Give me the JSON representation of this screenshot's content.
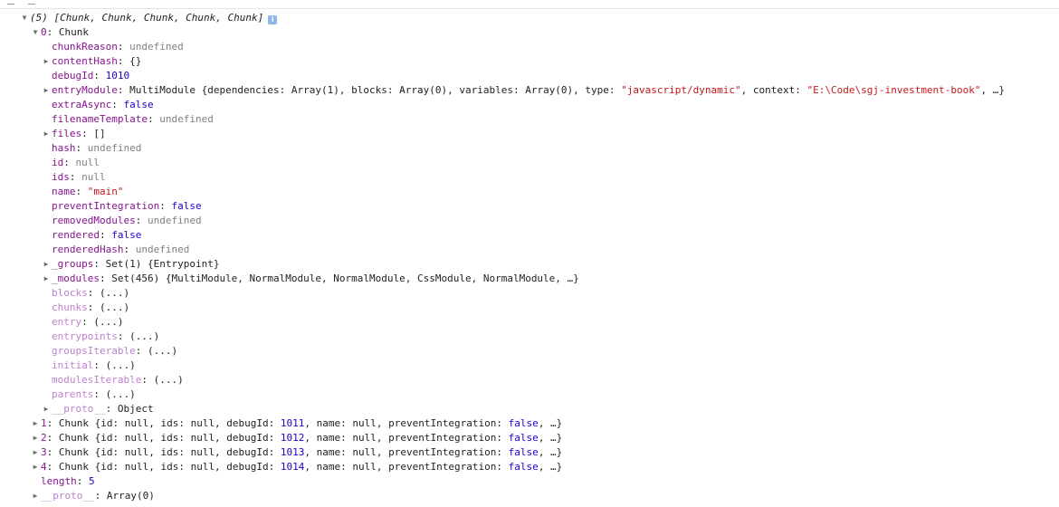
{
  "header": {
    "array_summary": "(5) [Chunk, Chunk, Chunk, Chunk, Chunk]",
    "info_icon_glyph": "i"
  },
  "rows": [
    {
      "indent": 1,
      "arrow": "down",
      "key": "0",
      "sep": ": ",
      "value": "Chunk",
      "vtype": "g"
    },
    {
      "indent": 2,
      "arrow": "none",
      "key": "chunkReason",
      "sep": ": ",
      "value": "undefined",
      "vtype": "u"
    },
    {
      "indent": 2,
      "arrow": "right",
      "key": "contentHash",
      "sep": ": ",
      "value": "{}",
      "vtype": "g"
    },
    {
      "indent": 2,
      "arrow": "none",
      "key": "debugId",
      "sep": ": ",
      "value": "1010",
      "vtype": "n"
    },
    {
      "indent": 2,
      "arrow": "right",
      "key": "entryModule",
      "sep": ": ",
      "vtype": "parts",
      "parts": [
        {
          "t": "MultiModule {dependencies: Array(1), blocks: Array(0), variables: Array(0), type: ",
          "c": "g"
        },
        {
          "t": "\"javascript/dynamic\"",
          "c": "s"
        },
        {
          "t": ", context: ",
          "c": "g"
        },
        {
          "t": "\"E:\\Code\\sgj-investment-book\"",
          "c": "s"
        },
        {
          "t": ", …}",
          "c": "g"
        }
      ]
    },
    {
      "indent": 2,
      "arrow": "none",
      "key": "extraAsync",
      "sep": ": ",
      "value": "false",
      "vtype": "n"
    },
    {
      "indent": 2,
      "arrow": "none",
      "key": "filenameTemplate",
      "sep": ": ",
      "value": "undefined",
      "vtype": "u"
    },
    {
      "indent": 2,
      "arrow": "right",
      "key": "files",
      "sep": ": ",
      "value": "[]",
      "vtype": "g"
    },
    {
      "indent": 2,
      "arrow": "none",
      "key": "hash",
      "sep": ": ",
      "value": "undefined",
      "vtype": "u"
    },
    {
      "indent": 2,
      "arrow": "none",
      "key": "id",
      "sep": ": ",
      "value": "null",
      "vtype": "u"
    },
    {
      "indent": 2,
      "arrow": "none",
      "key": "ids",
      "sep": ": ",
      "value": "null",
      "vtype": "u"
    },
    {
      "indent": 2,
      "arrow": "none",
      "key": "name",
      "sep": ": ",
      "value": "\"main\"",
      "vtype": "s"
    },
    {
      "indent": 2,
      "arrow": "none",
      "key": "preventIntegration",
      "sep": ": ",
      "value": "false",
      "vtype": "n"
    },
    {
      "indent": 2,
      "arrow": "none",
      "key": "removedModules",
      "sep": ": ",
      "value": "undefined",
      "vtype": "u"
    },
    {
      "indent": 2,
      "arrow": "none",
      "key": "rendered",
      "sep": ": ",
      "value": "false",
      "vtype": "n"
    },
    {
      "indent": 2,
      "arrow": "none",
      "key": "renderedHash",
      "sep": ": ",
      "value": "undefined",
      "vtype": "u"
    },
    {
      "indent": 2,
      "arrow": "right",
      "key": "_groups",
      "sep": ": ",
      "value": "Set(1) {Entrypoint}",
      "vtype": "g"
    },
    {
      "indent": 2,
      "arrow": "right",
      "key": "_modules",
      "sep": ": ",
      "value": "Set(456) {MultiModule, NormalModule, NormalModule, CssModule, NormalModule, …}",
      "vtype": "g"
    },
    {
      "indent": 2,
      "arrow": "none",
      "key": "blocks",
      "sep": ": ",
      "value": "(...)",
      "vtype": "g",
      "dim": true
    },
    {
      "indent": 2,
      "arrow": "none",
      "key": "chunks",
      "sep": ": ",
      "value": "(...)",
      "vtype": "g",
      "dim": true
    },
    {
      "indent": 2,
      "arrow": "none",
      "key": "entry",
      "sep": ": ",
      "value": "(...)",
      "vtype": "g",
      "dim": true
    },
    {
      "indent": 2,
      "arrow": "none",
      "key": "entrypoints",
      "sep": ": ",
      "value": "(...)",
      "vtype": "g",
      "dim": true
    },
    {
      "indent": 2,
      "arrow": "none",
      "key": "groupsIterable",
      "sep": ": ",
      "value": "(...)",
      "vtype": "g",
      "dim": true
    },
    {
      "indent": 2,
      "arrow": "none",
      "key": "initial",
      "sep": ": ",
      "value": "(...)",
      "vtype": "g",
      "dim": true
    },
    {
      "indent": 2,
      "arrow": "none",
      "key": "modulesIterable",
      "sep": ": ",
      "value": "(...)",
      "vtype": "g",
      "dim": true
    },
    {
      "indent": 2,
      "arrow": "none",
      "key": "parents",
      "sep": ": ",
      "value": "(...)",
      "vtype": "g",
      "dim": true
    },
    {
      "indent": 2,
      "arrow": "right",
      "key": "__proto__",
      "sep": ": ",
      "value": "Object",
      "vtype": "g",
      "dim": true
    },
    {
      "indent": 1,
      "arrow": "right",
      "key": "1",
      "sep": ": ",
      "vtype": "parts",
      "parts": [
        {
          "t": "Chunk {id: null, ids: null, debugId: ",
          "c": "g"
        },
        {
          "t": "1011",
          "c": "n"
        },
        {
          "t": ", name: null, preventIntegration: ",
          "c": "g"
        },
        {
          "t": "false",
          "c": "n"
        },
        {
          "t": ", …}",
          "c": "g"
        }
      ]
    },
    {
      "indent": 1,
      "arrow": "right",
      "key": "2",
      "sep": ": ",
      "vtype": "parts",
      "parts": [
        {
          "t": "Chunk {id: null, ids: null, debugId: ",
          "c": "g"
        },
        {
          "t": "1012",
          "c": "n"
        },
        {
          "t": ", name: null, preventIntegration: ",
          "c": "g"
        },
        {
          "t": "false",
          "c": "n"
        },
        {
          "t": ", …}",
          "c": "g"
        }
      ]
    },
    {
      "indent": 1,
      "arrow": "right",
      "key": "3",
      "sep": ": ",
      "vtype": "parts",
      "parts": [
        {
          "t": "Chunk {id: null, ids: null, debugId: ",
          "c": "g"
        },
        {
          "t": "1013",
          "c": "n"
        },
        {
          "t": ", name: null, preventIntegration: ",
          "c": "g"
        },
        {
          "t": "false",
          "c": "n"
        },
        {
          "t": ", …}",
          "c": "g"
        }
      ]
    },
    {
      "indent": 1,
      "arrow": "right",
      "key": "4",
      "sep": ": ",
      "vtype": "parts",
      "parts": [
        {
          "t": "Chunk {id: null, ids: null, debugId: ",
          "c": "g"
        },
        {
          "t": "1014",
          "c": "n"
        },
        {
          "t": ", name: null, preventIntegration: ",
          "c": "g"
        },
        {
          "t": "false",
          "c": "n"
        },
        {
          "t": ", …}",
          "c": "g"
        }
      ]
    },
    {
      "indent": 1,
      "arrow": "none",
      "key": "length",
      "sep": ": ",
      "value": "5",
      "vtype": "n"
    },
    {
      "indent": 1,
      "arrow": "right",
      "key": "__proto__",
      "sep": ": ",
      "value": "Array(0)",
      "vtype": "g",
      "dim": true
    }
  ],
  "colors": {
    "key": "#881391",
    "key_dim": "#c080d0",
    "number_bool": "#1c00cf",
    "string": "#c41a16",
    "undefined_null": "#808080",
    "info_icon": "#8fb6e8"
  }
}
